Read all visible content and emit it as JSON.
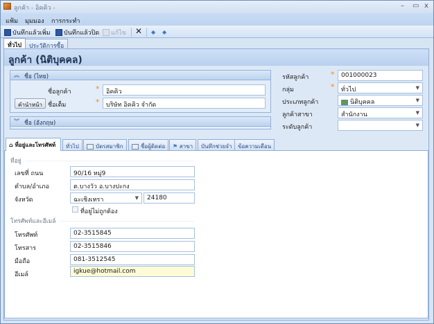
{
  "window": {
    "title": "ลูกค้า - อิคคิว -",
    "minimize": "–",
    "maximize": "▭",
    "close": "x"
  },
  "menu": [
    "แฟ้ม",
    "มุมมอง",
    "การกระทำ"
  ],
  "toolbar": {
    "save_new": "บันทึกแล้วเพิ่ม",
    "save_close": "บันทึกแล้วปิด",
    "edit": "แก้ไข",
    "delete": "✕",
    "prev": "◆",
    "next": "◆"
  },
  "top_tabs": [
    {
      "label": "ทั่วไป",
      "selected": true
    },
    {
      "label": "ประวัติการซื้อ",
      "selected": false
    }
  ],
  "header": {
    "title": "ลูกค้า (นิติบุคคล)"
  },
  "name_thai": {
    "title": "ชื่อ (ไทย)",
    "customer_name_label": "ชื่อลูกค้า",
    "customer_name": "อิคคิว",
    "prefix_button": "คำนำหน้า",
    "full_name_label": "ชื่อเต็ม",
    "full_name": "บริษัท อิคคิว จำกัด"
  },
  "name_english": {
    "title": "ชื่อ (อังกฤษ)"
  },
  "right": {
    "code_label": "รหัสลูกค้า",
    "code": "001000023",
    "group_label": "กลุ่ม",
    "group": "ทั่วไป",
    "type_label": "ประเภทลูกค้า",
    "type": "นิติบุคคล",
    "branch_label": "ลูกค้าสาขา",
    "branch": "สำนักงาน",
    "level_label": "ระดับลูกค้า",
    "level": ""
  },
  "bottom_tabs": [
    {
      "label": "ที่อยู่และโทรศัพท์",
      "selected": true
    },
    {
      "label": "ทั่วไป"
    },
    {
      "label": "บัตรสมาชิก"
    },
    {
      "label": "ชื่อผู้ติดต่อ"
    },
    {
      "label": "สาขา"
    },
    {
      "label": "บันทึกช่วยจำ"
    },
    {
      "label": "ข้อความเตือน"
    }
  ],
  "address": {
    "section": "ที่อยู่",
    "street_label": "เลขที่ ถนน",
    "street": "90/16 หมู่9",
    "district_label": "ตำบล/อำเภอ",
    "district": "ต.บางวัว อ.บางปะกง",
    "province_label": "จังหวัด",
    "province": "ฉะเชิงเทรา",
    "zip": "24180",
    "invalid_label": "ที่อยู่ไม่ถูกต้อง",
    "invalid": false
  },
  "contact": {
    "section": "โทรศัพท์และอีเมล์",
    "phone_label": "โทรศัพท์",
    "phone": "02-3515845",
    "fax_label": "โทรสาร",
    "fax": "02-3515846",
    "mobile_label": "มือถือ",
    "mobile": "081-3512545",
    "email_label": "อีเมล์",
    "email": "igkue@hotmail.com"
  },
  "colors": {
    "required": "#f08a1c",
    "focus": "#fffbd6",
    "accent": "#2c57a8"
  }
}
